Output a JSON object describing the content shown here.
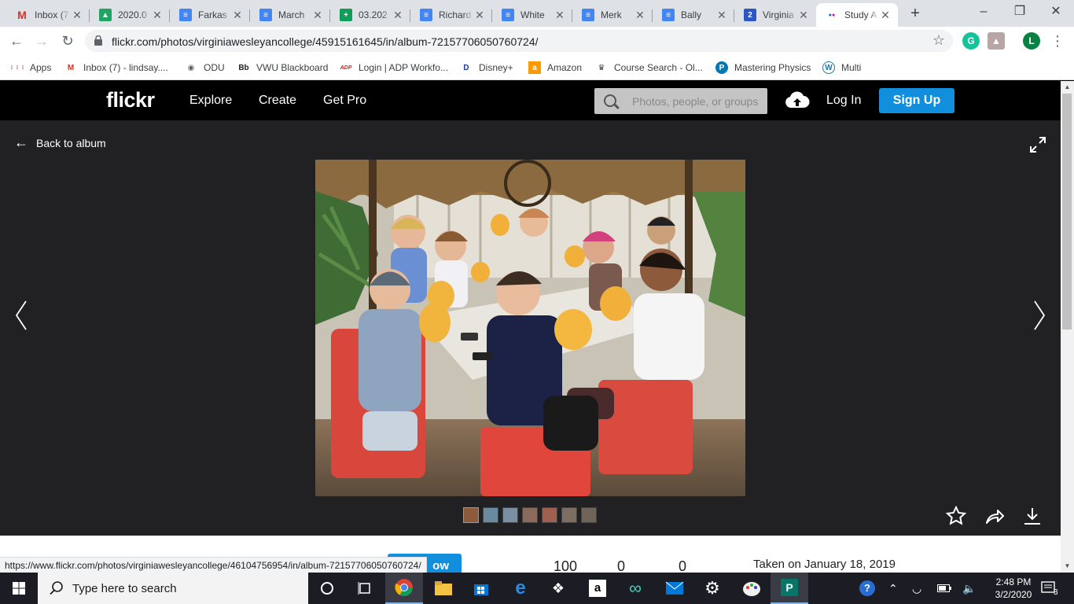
{
  "tabs": [
    {
      "title": "Inbox (7",
      "favicon": "gmail-icon",
      "color": "#d93025",
      "glyph": "M"
    },
    {
      "title": "2020.0",
      "favicon": "drive-icon",
      "color": "#1fa463",
      "glyph": "▲"
    },
    {
      "title": "Farkas",
      "favicon": "docs-icon",
      "color": "#4285f4",
      "glyph": "≡"
    },
    {
      "title": "March",
      "favicon": "docs-icon",
      "color": "#4285f4",
      "glyph": "≡"
    },
    {
      "title": "03.202",
      "favicon": "sheets-icon",
      "color": "#0f9d58",
      "glyph": "+"
    },
    {
      "title": "Richard",
      "favicon": "docs-icon",
      "color": "#4285f4",
      "glyph": "≡"
    },
    {
      "title": "White",
      "favicon": "docs-icon",
      "color": "#4285f4",
      "glyph": "≡"
    },
    {
      "title": "Merk",
      "favicon": "docs-icon",
      "color": "#4285f4",
      "glyph": "≡"
    },
    {
      "title": "Bally",
      "favicon": "docs-icon",
      "color": "#4285f4",
      "glyph": "≡"
    },
    {
      "title": "Virginia",
      "favicon": "calendar-icon",
      "color": "#2a56c6",
      "glyph": "2"
    },
    {
      "title": "Study A",
      "favicon": "flickr-icon",
      "color": "#ffffff",
      "glyph": "••"
    }
  ],
  "url": "flickr.com/photos/virginiawesleyancollege/45915161645/in/album-72157706050760724/",
  "profile_initial": "L",
  "bookmarks": [
    {
      "label": "Apps",
      "icon": "apps-grid-icon"
    },
    {
      "label": "Inbox (7) - lindsay....",
      "icon": "gmail-icon"
    },
    {
      "label": "ODU",
      "icon": "globe-icon"
    },
    {
      "label": "VWU Blackboard",
      "icon": "blackboard-icon"
    },
    {
      "label": "Login | ADP Workfo...",
      "icon": "adp-icon"
    },
    {
      "label": "Disney+",
      "icon": "disney-icon"
    },
    {
      "label": "Amazon",
      "icon": "amazon-icon"
    },
    {
      "label": "Course Search - Ol...",
      "icon": "odu-crown-icon"
    },
    {
      "label": "Mastering Physics",
      "icon": "pearson-icon"
    },
    {
      "label": "Multi",
      "icon": "wordpress-icon"
    }
  ],
  "flickr": {
    "logo": "flickr",
    "nav": [
      "Explore",
      "Create",
      "Get Pro"
    ],
    "search_placeholder": "Photos, people, or groups",
    "login": "Log In",
    "signup": "Sign Up",
    "back_label": "Back to album",
    "follow_label": "ow",
    "stats": [
      "100",
      "0",
      "0"
    ],
    "taken": "Taken on January 18, 2019"
  },
  "status_url": "https://www.flickr.com/photos/virginiawesleyancollege/46104756954/in/album-72157706050760724/",
  "taskbar": {
    "search_placeholder": "Type here to search",
    "time": "2:48 PM",
    "date": "3/2/2020",
    "notification_count": "3"
  }
}
